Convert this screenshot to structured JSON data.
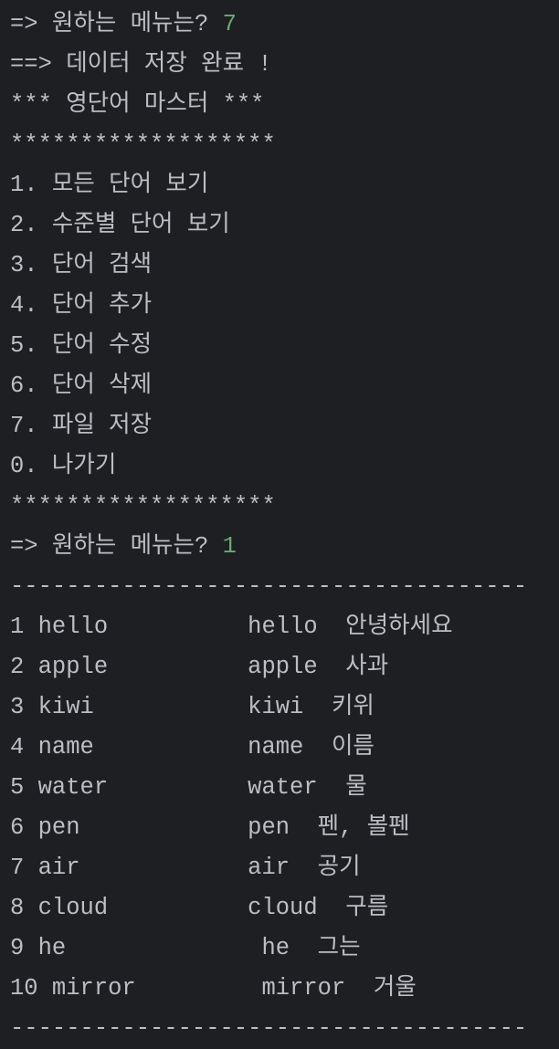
{
  "colors": {
    "background": "#1e1f22",
    "text": "#bcbec4",
    "user_input": "#6aab73"
  },
  "console": {
    "lines": [
      {
        "text": "=> 원하는 메뉴는? ",
        "input": "7"
      },
      {
        "text": "==> 데이터 저장 완료 !"
      },
      {
        "text": "*** 영단어 마스터 ***"
      },
      {
        "text": "*******************"
      },
      {
        "text": "1. 모든 단어 보기"
      },
      {
        "text": "2. 수준별 단어 보기"
      },
      {
        "text": "3. 단어 검색"
      },
      {
        "text": "4. 단어 추가"
      },
      {
        "text": "5. 단어 수정"
      },
      {
        "text": "6. 단어 삭제"
      },
      {
        "text": "7. 파일 저장"
      },
      {
        "text": "0. 나가기"
      },
      {
        "text": "*******************"
      },
      {
        "text": "=> 원하는 메뉴는? ",
        "input": "1"
      },
      {
        "text": "-------------------------------------"
      },
      {
        "text": "1 hello          hello  안녕하세요"
      },
      {
        "text": "2 apple          apple  사과"
      },
      {
        "text": "3 kiwi           kiwi  키위"
      },
      {
        "text": "4 name           name  이름"
      },
      {
        "text": "5 water          water  물"
      },
      {
        "text": "6 pen            pen  펜, 볼펜"
      },
      {
        "text": "7 air            air  공기"
      },
      {
        "text": "8 cloud          cloud  구름"
      },
      {
        "text": "9 he              he  그는"
      },
      {
        "text": "10 mirror         mirror  거울"
      },
      {
        "text": "-------------------------------------"
      }
    ]
  }
}
